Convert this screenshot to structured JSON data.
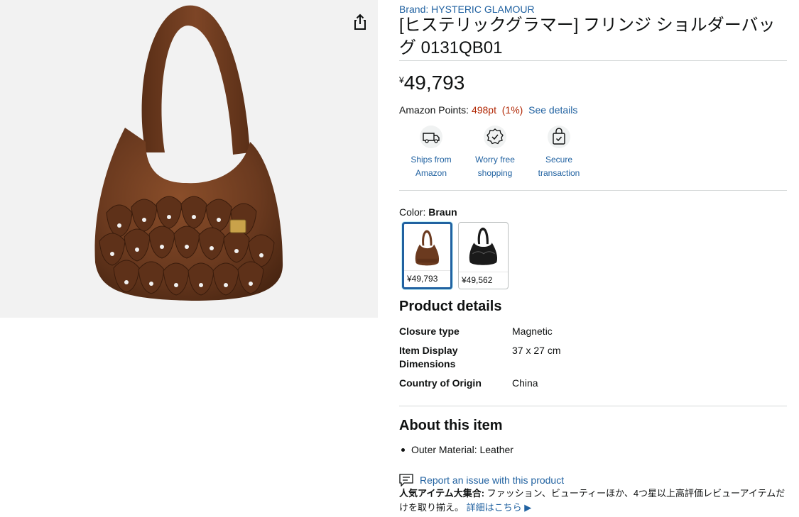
{
  "product": {
    "brand": "Brand: HYSTERIC GLAMOUR",
    "title": "[ヒステリックグラマー] フリンジ ショルダーバッグ 0131QB01",
    "price_symbol": "¥",
    "price": "49,793"
  },
  "points": {
    "label": "Amazon Points: ",
    "value": "498pt",
    "percent": "(1%)",
    "link": "See details"
  },
  "badges": [
    {
      "label": "Ships from Amazon",
      "icon": "delivery-van-icon"
    },
    {
      "label": "Worry free shopping",
      "icon": "badge-check-icon"
    },
    {
      "label": "Secure transaction",
      "icon": "secure-bag-icon"
    }
  ],
  "color": {
    "label": "Color: ",
    "selected": "Braun",
    "options": [
      {
        "price": "¥49,793",
        "color": "#6b3a1f",
        "selected": true
      },
      {
        "price": "¥49,562",
        "color": "#1a1a1a",
        "selected": false
      }
    ]
  },
  "details": {
    "heading": "Product details",
    "rows": [
      {
        "label": "Closure type",
        "value": "Magnetic"
      },
      {
        "label": "Item Display Dimensions",
        "value": "37 x 27 cm"
      },
      {
        "label": "Country of Origin",
        "value": "China"
      }
    ]
  },
  "about": {
    "heading": "About this item",
    "bullets": [
      "Outer Material: Leather"
    ]
  },
  "report": {
    "label": "Report an issue with this product"
  },
  "promo": {
    "bold": "人気アイテム大集合:",
    "text": " ファッション、ビューティーほか、4つ星以上高評価レビューアイテムだけを取り揃え。 ",
    "link": "詳細はこちら ▶"
  },
  "colors": {
    "link": "#2162a1",
    "points": "#b12704",
    "selected_border": "#2162a1",
    "bag_brown": "#6b3a1f"
  }
}
